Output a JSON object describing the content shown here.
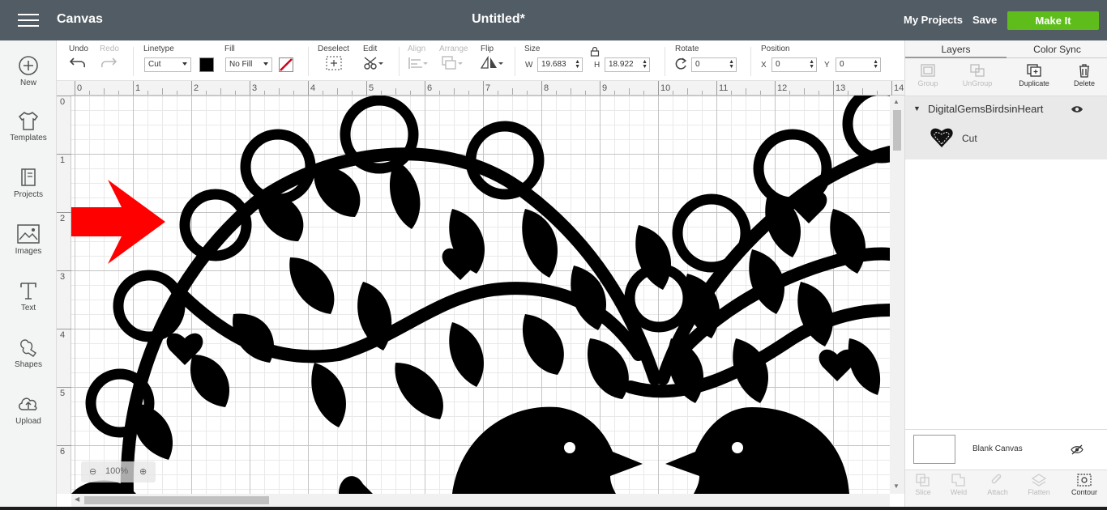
{
  "header": {
    "app_title": "Canvas",
    "doc_title": "Untitled*",
    "my_projects": "My Projects",
    "save": "Save",
    "make_it": "Make It"
  },
  "leftbar": {
    "items": [
      {
        "label": "New",
        "icon": "plus-circle-icon"
      },
      {
        "label": "Templates",
        "icon": "tshirt-icon"
      },
      {
        "label": "Projects",
        "icon": "book-icon"
      },
      {
        "label": "Images",
        "icon": "image-icon"
      },
      {
        "label": "Text",
        "icon": "text-icon"
      },
      {
        "label": "Shapes",
        "icon": "shapes-icon"
      },
      {
        "label": "Upload",
        "icon": "upload-cloud-icon"
      }
    ]
  },
  "toolbar": {
    "undo": "Undo",
    "redo": "Redo",
    "linetype_label": "Linetype",
    "linetype_value": "Cut",
    "fill_label": "Fill",
    "fill_value": "No Fill",
    "deselect": "Deselect",
    "edit": "Edit",
    "align": "Align",
    "arrange": "Arrange",
    "flip": "Flip",
    "size_label": "Size",
    "w_label": "W",
    "w_value": "19.683",
    "h_label": "H",
    "h_value": "18.922",
    "rotate_label": "Rotate",
    "rotate_value": "0",
    "position_label": "Position",
    "x_label": "X",
    "x_value": "0",
    "y_label": "Y",
    "y_value": "0",
    "colors": {
      "linetype_swatch": "#000000",
      "fill_none": "#d0021b"
    }
  },
  "ruler": {
    "top": [
      "0",
      "1",
      "2",
      "3",
      "4",
      "5",
      "6",
      "7",
      "8",
      "9",
      "10",
      "11",
      "12",
      "13",
      "14"
    ],
    "left": [
      "0",
      "1",
      "2",
      "3",
      "4",
      "5",
      "6"
    ]
  },
  "canvas": {
    "zoom": "100%"
  },
  "right_panel": {
    "tabs": [
      "Layers",
      "Color Sync"
    ],
    "tools": [
      "Group",
      "UnGroup",
      "Duplicate",
      "Delete"
    ],
    "layer_group_name": "DigitalGemsBirdsinHeart",
    "layer_item_label": "Cut",
    "blank_canvas": "Blank Canvas",
    "bottom_tools": [
      "Slice",
      "Weld",
      "Attach",
      "Flatten",
      "Contour"
    ]
  },
  "colors": {
    "header_bg": "#525c64",
    "make_it": "#5ebd1b",
    "arrow": "#ff0000",
    "art": "#000000"
  }
}
